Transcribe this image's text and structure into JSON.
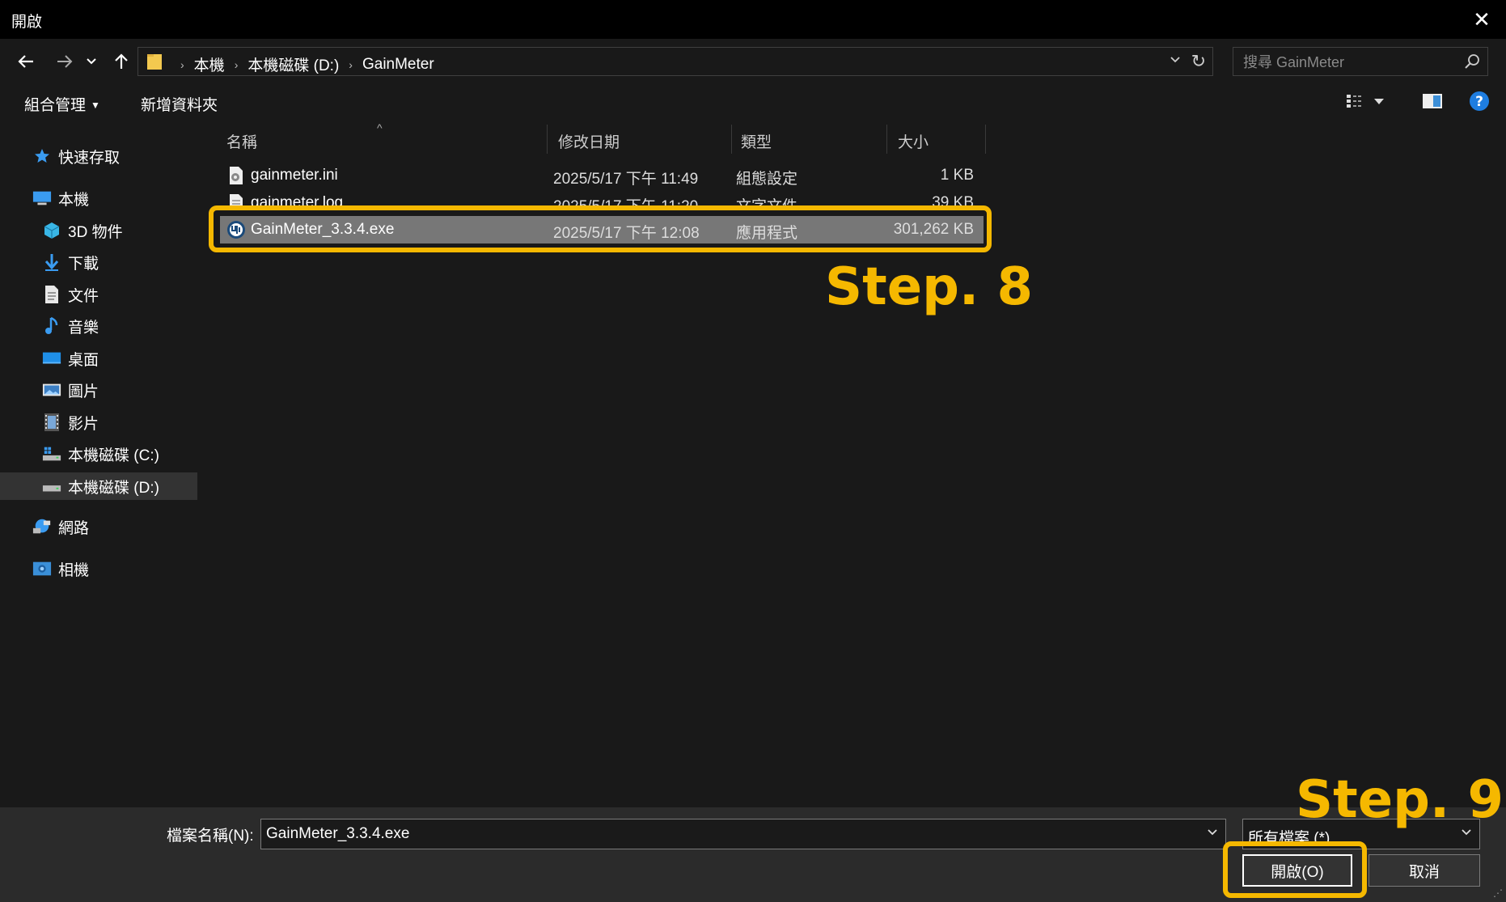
{
  "window": {
    "title": "開啟"
  },
  "address": {
    "crumbs": [
      "本機",
      "本機磁碟 (D:)",
      "GainMeter"
    ]
  },
  "search": {
    "placeholder": "搜尋 GainMeter"
  },
  "commands": {
    "organize": "組合管理",
    "new_folder": "新增資料夾"
  },
  "sidebar": {
    "items": [
      {
        "label": "快速存取",
        "icon": "star-icon"
      },
      {
        "label": "本機",
        "icon": "computer-icon"
      },
      {
        "label": "3D 物件",
        "icon": "cube-icon"
      },
      {
        "label": "下載",
        "icon": "download-arrow-icon"
      },
      {
        "label": "文件",
        "icon": "document-icon"
      },
      {
        "label": "音樂",
        "icon": "music-note-icon"
      },
      {
        "label": "桌面",
        "icon": "desktop-icon"
      },
      {
        "label": "圖片",
        "icon": "pictures-icon"
      },
      {
        "label": "影片",
        "icon": "film-icon"
      },
      {
        "label": "本機磁碟 (C:)",
        "icon": "system-drive-icon"
      },
      {
        "label": "本機磁碟 (D:)",
        "icon": "drive-icon"
      },
      {
        "label": "網路",
        "icon": "network-icon"
      },
      {
        "label": "相機",
        "icon": "camera-icon"
      }
    ]
  },
  "columns": {
    "name": "名稱",
    "date": "修改日期",
    "type": "類型",
    "size": "大小"
  },
  "files": [
    {
      "name": "gainmeter.ini",
      "date": "2025/5/17 下午 11:49",
      "type": "組態設定",
      "size": "1 KB",
      "icon": "settings-file-icon"
    },
    {
      "name": "gainmeter.log",
      "date": "2025/5/17 下午 11:20",
      "type": "文字文件",
      "size": "39 KB",
      "icon": "text-file-icon"
    },
    {
      "name": "GainMeter_3.3.4.exe",
      "date": "2025/5/17 下午 12:08",
      "type": "應用程式",
      "size": "301,262 KB",
      "icon": "app-icon"
    }
  ],
  "footer": {
    "filename_label": "檔案名稱(N):",
    "filename_value": "GainMeter_3.3.4.exe",
    "filetype": "所有檔案 (*)",
    "open_label": "開啟(O)",
    "cancel_label": "取消"
  },
  "annotations": {
    "step8": "Step. 8",
    "step9": "Step. 9",
    "color": "#f5b800"
  },
  "colors": {
    "selected_row": "#777777",
    "background": "#191919"
  }
}
